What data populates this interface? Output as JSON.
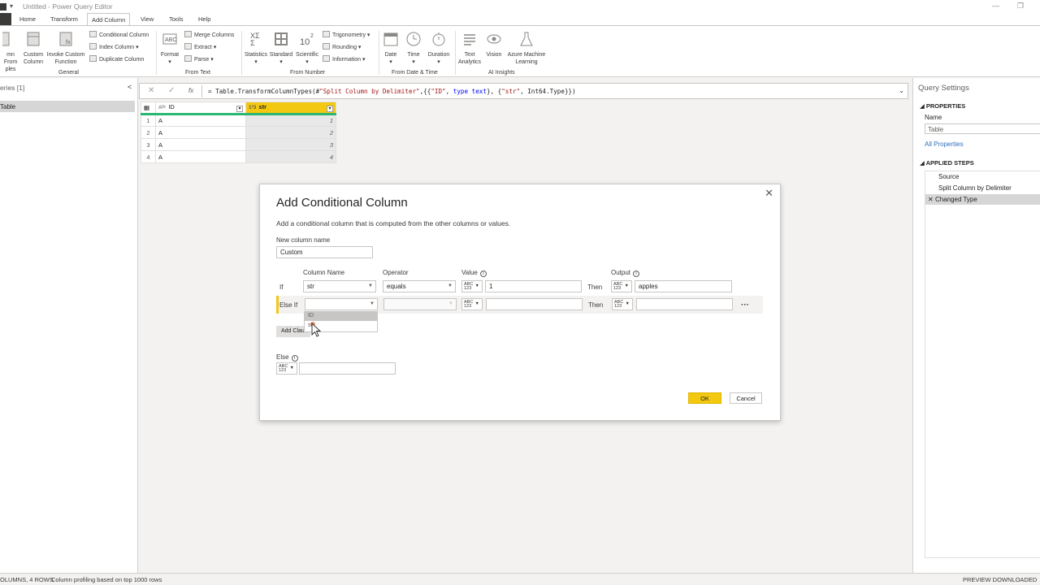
{
  "window": {
    "title": "Untitled - Power Query Editor",
    "minimize": "—",
    "restore": "❐"
  },
  "tabs": [
    "Home",
    "Transform",
    "Add Column",
    "View",
    "Tools",
    "Help"
  ],
  "active_tab": "Add Column",
  "ribbon": {
    "general": {
      "label": "General",
      "col_from_examples_1": "mn From",
      "col_from_examples_2": "ples",
      "custom_column_1": "Custom",
      "custom_column_2": "Column",
      "invoke_1": "Invoke Custom",
      "invoke_2": "Function",
      "conditional_column": "Conditional Column",
      "index_column": "Index Column",
      "duplicate_column": "Duplicate Column"
    },
    "from_text": {
      "label": "From Text",
      "format": "Format",
      "merge_columns": "Merge Columns",
      "extract": "Extract",
      "parse": "Parse"
    },
    "from_number": {
      "label": "From Number",
      "statistics": "Statistics",
      "standard": "Standard",
      "scientific": "Scientific",
      "trigonometry": "Trigonometry",
      "rounding": "Rounding",
      "information": "Information"
    },
    "from_date_time": {
      "label": "From Date & Time",
      "date": "Date",
      "time": "Time",
      "duration": "Duration"
    },
    "ai_insights": {
      "label": "AI Insights",
      "text_analytics_1": "Text",
      "text_analytics_2": "Analytics",
      "vision": "Vision",
      "azure_ml_1": "Azure Machine",
      "azure_ml_2": "Learning"
    }
  },
  "queries": {
    "header": "eries [1]",
    "items": [
      "Table"
    ]
  },
  "formula_bar": {
    "prefix": "= Table.TransformColumnTypes(#",
    "str1": "\"Split Column by Delimiter\"",
    "mid1": ",{{",
    "str2": "\"ID\"",
    "mid2": ", ",
    "kw1": "type text",
    "mid3": "}, {",
    "str3": "\"str\"",
    "mid4": ", Int64.Type}})"
  },
  "grid": {
    "columns": [
      {
        "name": "ID",
        "type_icon": "Aᴮᶜ"
      },
      {
        "name": "str",
        "type_icon": "1²3"
      }
    ],
    "rows": [
      {
        "n": "1",
        "id": "A",
        "str": "1"
      },
      {
        "n": "2",
        "id": "A",
        "str": "2"
      },
      {
        "n": "3",
        "id": "A",
        "str": "3"
      },
      {
        "n": "4",
        "id": "A",
        "str": "4"
      }
    ]
  },
  "query_settings": {
    "header": "Query Settings",
    "properties": "PROPERTIES",
    "name_label": "Name",
    "name_value": "Table",
    "all_properties": "All Properties",
    "applied_steps": "APPLIED STEPS",
    "steps": [
      "Source",
      "Split Column by Delimiter",
      "Changed Type"
    ]
  },
  "status": {
    "left": "OLUMNS, 4 ROWS",
    "profiling": "Column profiling based on top 1000 rows",
    "right": "PREVIEW DOWNLOADED AT"
  },
  "dialog": {
    "title": "Add Conditional Column",
    "description": "Add a conditional column that is computed from the other columns or values.",
    "new_column_label": "New column name",
    "new_column_value": "Custom",
    "headers": {
      "column_name": "Column Name",
      "operator": "Operator",
      "value": "Value",
      "output": "Output"
    },
    "if_row": {
      "label": "If",
      "column": "str",
      "operator": "equals",
      "value": "1",
      "then": "Then",
      "output": "apples"
    },
    "elseif_row": {
      "label": "Else If",
      "column": "",
      "operator": "",
      "value": "",
      "then": "Then",
      "output": ""
    },
    "type_badge_1": "ABC",
    "type_badge_2": "123",
    "more": "···",
    "add_clause": "Add Clause",
    "else_label": "Else",
    "ok": "OK",
    "cancel": "Cancel",
    "dropdown_options": [
      "ID",
      "str"
    ]
  }
}
